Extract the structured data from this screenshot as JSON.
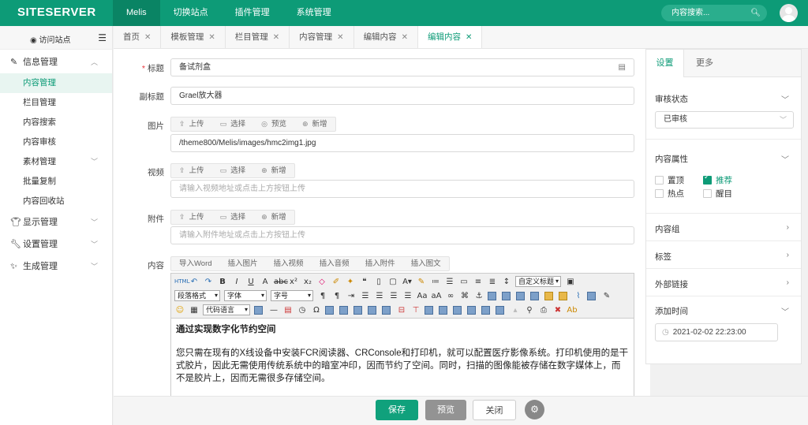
{
  "app": {
    "logo": "SITESERVER"
  },
  "topnav": {
    "items": [
      "Melis",
      "切换站点",
      "插件管理",
      "系统管理"
    ],
    "search_placeholder": "内容搜索..."
  },
  "sidebar": {
    "visit": "访问站点",
    "groups": [
      {
        "label": "信息管理",
        "icon": "edit-icon",
        "expanded": true
      },
      {
        "label": "显示管理",
        "icon": "tshirt-icon"
      },
      {
        "label": "设置管理",
        "icon": "wrench-icon"
      },
      {
        "label": "生成管理",
        "icon": "magic-icon"
      }
    ],
    "items": [
      "内容管理",
      "栏目管理",
      "内容搜索",
      "内容审核",
      "素材管理",
      "批量复制",
      "内容回收站"
    ]
  },
  "tabs": [
    "首页",
    "模板管理",
    "栏目管理",
    "内容管理",
    "编辑内容",
    "编辑内容"
  ],
  "form": {
    "title_label": "标题",
    "title_value": "备试剂盒",
    "subtitle_label": "副标题",
    "subtitle_value": "Grael放大器",
    "image_label": "图片",
    "image_buttons": [
      "上传",
      "选择",
      "预览",
      "新增"
    ],
    "image_value": "/theme800/Melis/images/hmc2img1.jpg",
    "video_label": "视频",
    "video_buttons": [
      "上传",
      "选择",
      "新增"
    ],
    "video_placeholder": "请输入视频地址或点击上方按钮上传",
    "attach_label": "附件",
    "attach_buttons": [
      "上传",
      "选择",
      "新增"
    ],
    "attach_placeholder": "请输入附件地址或点击上方按钮上传",
    "content_label": "内容",
    "content_buttons": [
      "导入Word",
      "插入图片",
      "插入视频",
      "插入音频",
      "插入附件",
      "插入图文"
    ]
  },
  "editor": {
    "selects": {
      "custom_title": "自定义标题",
      "paragraph": "段落格式",
      "font": "字体",
      "size": "字号",
      "code_lang": "代码语言"
    },
    "heading": "通过实现数字化节约空间",
    "paragraph": "您只需在现有的X线设备中安装FCR阅读器、CRConsole和打印机，就可以配置医疗影像系统。打印机使用的是干式胶片，因此无需使用传统系统中的暗室冲印，因而节约了空间。同时，扫描的图像能被存储在数字媒体上，而不是胶片上，因而无需很多存储空间。"
  },
  "footer": {
    "save": "保存",
    "preview": "预览",
    "close": "关闭"
  },
  "right": {
    "tabs": [
      "设置",
      "更多"
    ],
    "review_label": "审核状态",
    "review_value": "已审核",
    "attr_label": "内容属性",
    "attrs": [
      {
        "label": "置顶",
        "checked": false
      },
      {
        "label": "推荐",
        "checked": true
      },
      {
        "label": "热点",
        "checked": false
      },
      {
        "label": "醒目",
        "checked": false
      }
    ],
    "group_label": "内容组",
    "tag_label": "标签",
    "link_label": "外部链接",
    "date_label": "添加时间",
    "date_value": "2021-02-02 22:23:00"
  },
  "colors": {
    "brand": "#0d9b77",
    "save": "#10a17c"
  }
}
